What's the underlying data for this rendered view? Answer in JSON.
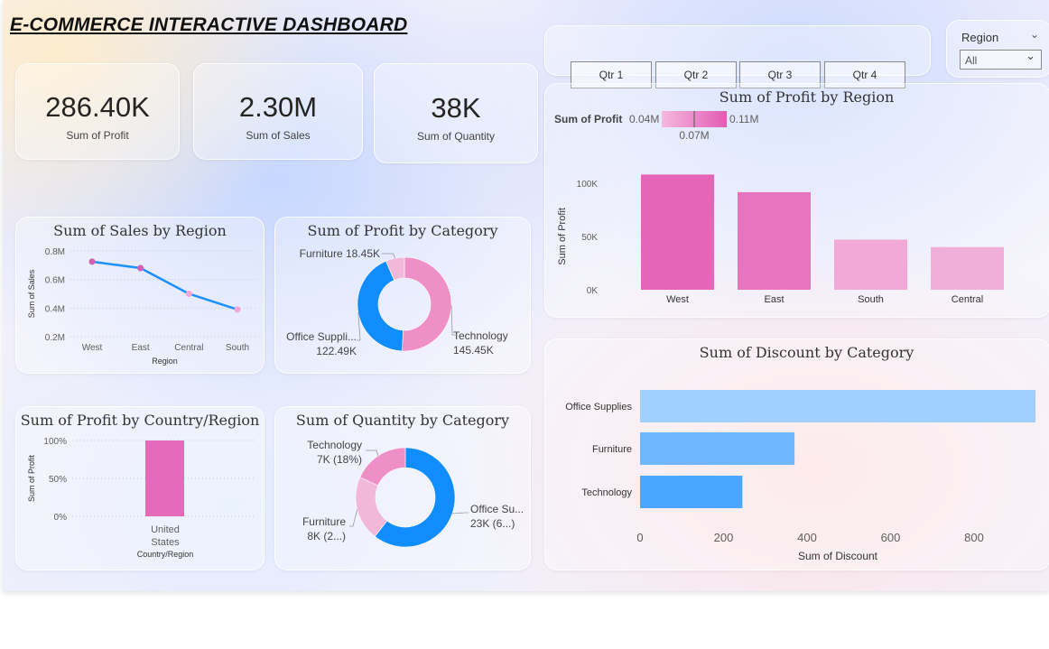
{
  "header": {
    "title": "E-COMMERCE INTERACTIVE DASHBOARD"
  },
  "kpis": [
    {
      "value": "286.40K",
      "label": "Sum of Profit"
    },
    {
      "value": "2.30M",
      "label": "Sum of Sales"
    },
    {
      "value": "38K",
      "label": "Sum of Quantity"
    }
  ],
  "quarters": [
    "Qtr 1",
    "Qtr 2",
    "Qtr 3",
    "Qtr 4"
  ],
  "region_slicer": {
    "label": "Region",
    "value": "All"
  },
  "colors": {
    "accent_blue": "#118DFF",
    "line_blue": "#1E90FF",
    "pink": "#E66AB9",
    "light_blue": "#9FD0FF"
  },
  "chart_data": [
    {
      "id": "sales_by_region",
      "type": "line",
      "title": "Sum of Sales by Region",
      "xlabel": "Region",
      "ylabel": "Sum of Sales",
      "categories": [
        "West",
        "East",
        "Central",
        "South"
      ],
      "values": [
        725000,
        680000,
        500000,
        390000
      ],
      "yticks": [
        "0.8M",
        "0.6M",
        "0.4M",
        "0.2M"
      ],
      "ylim": [
        200000,
        800000
      ],
      "grid": true
    },
    {
      "id": "profit_by_category",
      "type": "pie",
      "title": "Sum of Profit by Category",
      "categories": [
        "Technology",
        "Office Suppli...",
        "Furniture"
      ],
      "values": [
        145450,
        122490,
        18450
      ],
      "labels": [
        "145.45K",
        "122.49K",
        "18.45K"
      ],
      "colors": [
        "#EE8FC8",
        "#118DFF",
        "#F2B8DA"
      ]
    },
    {
      "id": "profit_by_region",
      "type": "bar",
      "title": "Sum of Profit by Region",
      "ylabel": "Sum of Profit",
      "categories": [
        "West",
        "East",
        "South",
        "Central"
      ],
      "values": [
        108000,
        91500,
        47000,
        40000
      ],
      "yticks": [
        "100K",
        "50K",
        "0K"
      ],
      "ylim": [
        0,
        110000
      ],
      "colors": [
        "#E566B8",
        "#E874BF",
        "#F2A9D7",
        "#F0AED8"
      ],
      "legend": {
        "title": "Sum of Profit",
        "min": "0.04M",
        "mid": "0.07M",
        "max": "0.11M"
      }
    },
    {
      "id": "profit_by_country",
      "type": "bar",
      "title": "Sum of Profit by Country/Region",
      "xlabel": "Country/Region",
      "ylabel": "Sum of Profit",
      "categories": [
        "United States"
      ],
      "values": [
        100
      ],
      "yticks": [
        "100%",
        "50%",
        "0%"
      ],
      "ylim": [
        0,
        100
      ]
    },
    {
      "id": "quantity_by_category",
      "type": "pie",
      "title": "Sum of Quantity by Category",
      "categories": [
        "Office Su...",
        "Furniture",
        "Technology"
      ],
      "values": [
        23000,
        8000,
        7000
      ],
      "labels": [
        "23K (6...)",
        "8K (2...)",
        "7K (18%)"
      ],
      "colors": [
        "#118DFF",
        "#F2B8DA",
        "#EE8FC8"
      ]
    },
    {
      "id": "discount_by_category",
      "type": "bar",
      "orientation": "horizontal",
      "title": "Sum of Discount by Category",
      "xlabel": "Sum of Discount",
      "categories": [
        "Office Supplies",
        "Furniture",
        "Technology"
      ],
      "values": [
        950,
        370,
        245
      ],
      "xticks": [
        "0",
        "200",
        "400",
        "600",
        "800"
      ],
      "xlim": [
        0,
        800
      ],
      "colors": [
        "#9FD0FF",
        "#6FB8FF",
        "#4BA6FF"
      ]
    }
  ]
}
